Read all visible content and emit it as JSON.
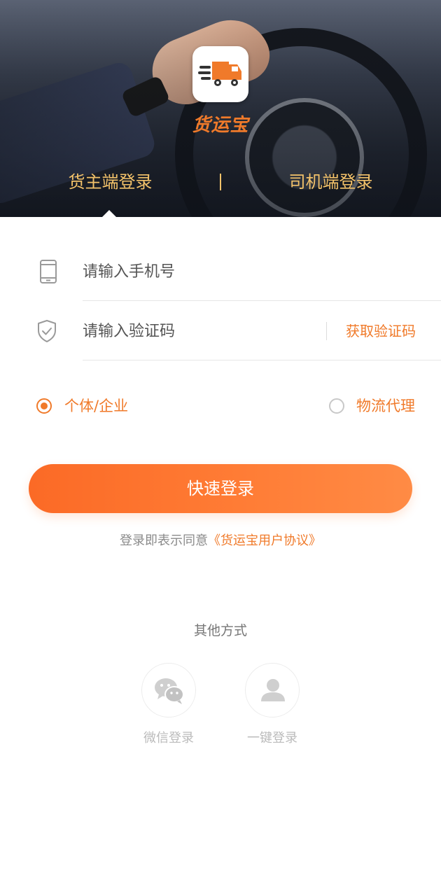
{
  "header": {
    "logo_text": "货运宝",
    "tabs": [
      {
        "label": "货主端登录",
        "active": true
      },
      {
        "label": "司机端登录",
        "active": false
      }
    ]
  },
  "form": {
    "phone_placeholder": "请输入手机号",
    "code_placeholder": "请输入验证码",
    "get_code_label": "获取验证码",
    "user_types": [
      {
        "label": "个体/企业",
        "selected": true
      },
      {
        "label": "物流代理",
        "selected": false
      }
    ],
    "login_button": "快速登录",
    "agreement_prefix": "登录即表示同意",
    "agreement_link": "《货运宝用户协议》"
  },
  "other_methods": {
    "title": "其他方式",
    "items": [
      {
        "label": "微信登录",
        "icon": "wechat-icon"
      },
      {
        "label": "一键登录",
        "icon": "user-icon"
      }
    ]
  },
  "colors": {
    "accent": "#f07a2a",
    "tab_text": "#f3c26a",
    "button_gradient_start": "#fb6a26",
    "button_gradient_end": "#ff8b45"
  }
}
